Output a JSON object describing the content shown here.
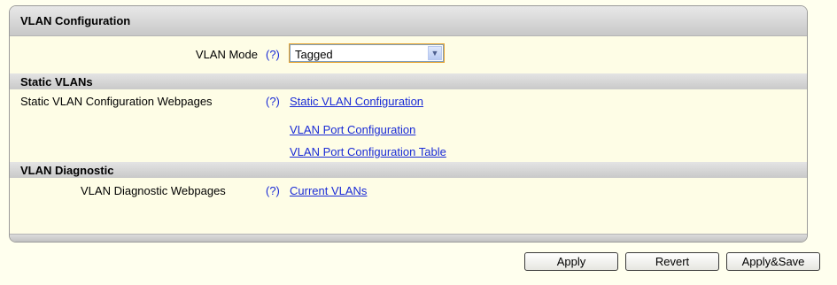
{
  "panel": {
    "title": "VLAN Configuration",
    "vlan_mode": {
      "label": "VLAN Mode",
      "help": "(?)",
      "selected": "Tagged"
    }
  },
  "static_vlans": {
    "heading": "Static VLANs",
    "label": "Static VLAN Configuration Webpages",
    "help": "(?)",
    "links": [
      "Static VLAN Configuration",
      "VLAN Port Configuration",
      "VLAN Port Configuration Table"
    ]
  },
  "vlan_diagnostic": {
    "heading": "VLAN Diagnostic",
    "label": "VLAN Diagnostic Webpages",
    "help": "(?)",
    "links": [
      "Current VLANs"
    ]
  },
  "buttons": {
    "apply": "Apply",
    "revert": "Revert",
    "apply_save": "Apply&Save"
  },
  "colors": {
    "page_bg": "#ffffee",
    "link": "#1a2bd6"
  }
}
